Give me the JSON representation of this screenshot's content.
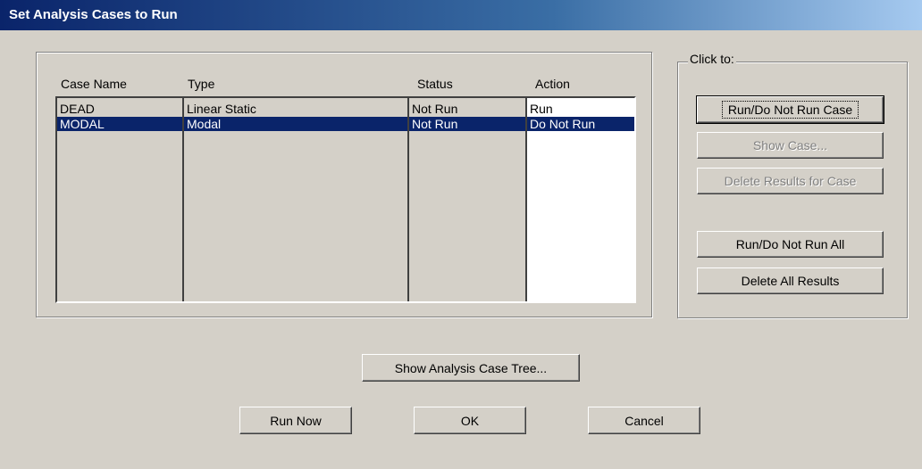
{
  "window": {
    "title": "Set Analysis Cases to Run"
  },
  "table": {
    "headers": {
      "case_name": "Case Name",
      "type": "Type",
      "status": "Status",
      "action": "Action"
    },
    "rows": [
      {
        "case_name": "DEAD",
        "type": "Linear Static",
        "status": "Not Run",
        "action": "Run",
        "selected": false
      },
      {
        "case_name": "MODAL",
        "type": "Modal",
        "status": "Not Run",
        "action": "Do Not Run",
        "selected": true
      }
    ]
  },
  "click_to": {
    "legend": "Click to:",
    "run_do_not_run_case": "Run/Do Not Run Case",
    "show_case": "Show Case...",
    "delete_results_for_case": "Delete Results for Case",
    "run_do_not_run_all": "Run/Do Not Run All",
    "delete_all_results": "Delete All Results"
  },
  "buttons": {
    "show_analysis_case_tree": "Show Analysis Case Tree...",
    "run_now": "Run Now",
    "ok": "OK",
    "cancel": "Cancel"
  },
  "colors": {
    "selection": "#0a246a",
    "face": "#d4d0c8",
    "title_start": "#0a246a"
  }
}
